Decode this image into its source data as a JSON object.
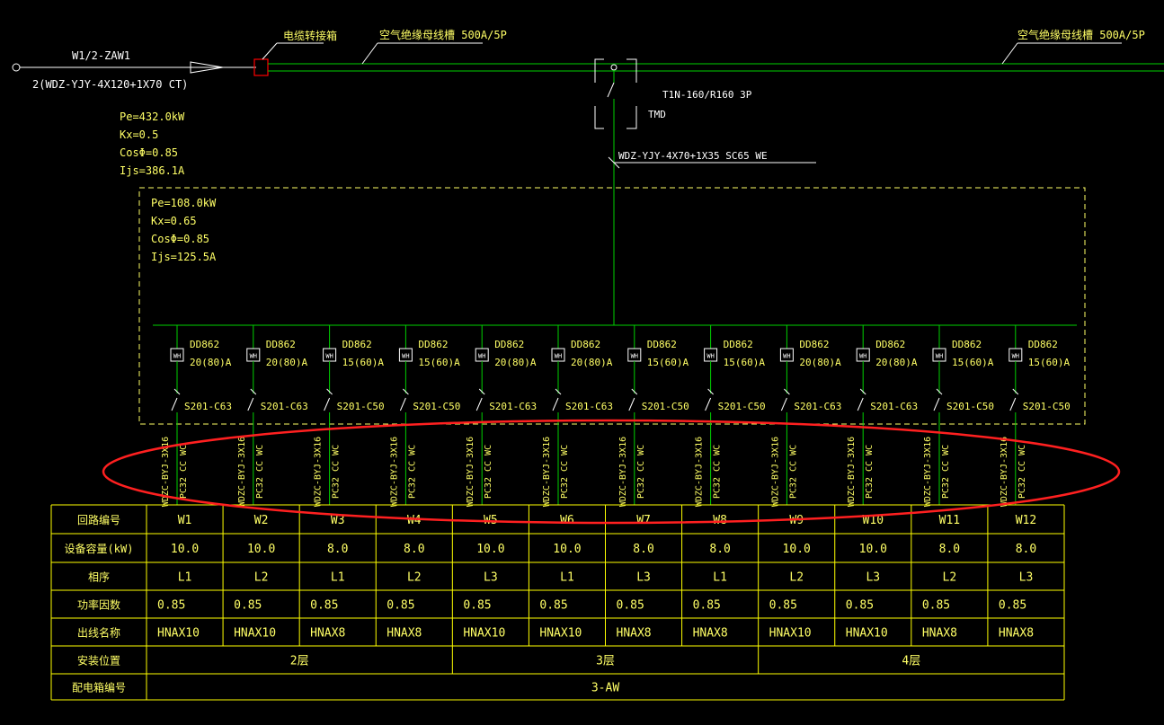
{
  "incoming": {
    "feeder_id": "W1/2-ZAW1",
    "cable": "2(WDZ-YJY-4X120+1X70 CT)",
    "cable_box_label": "电缆转接箱",
    "busway_left": "空气绝缘母线槽 500A/5P",
    "busway_right": "空气绝缘母线槽 500A/5P",
    "load_pe": "Pe=432.0kW",
    "load_kx": "Kx=0.5",
    "load_cos": "CosΦ=0.85",
    "load_ijs": "Ijs=386.1A"
  },
  "tap": {
    "breaker": "T1N-160/R160 3P",
    "tmd": "TMD",
    "cable": "WDZ-YJY-4X70+1X35 SC65 WE"
  },
  "panel": {
    "load_pe": "Pe=108.0kW",
    "load_kx": "Kx=0.65",
    "load_cos": "CosΦ=0.85",
    "load_ijs": "Ijs=125.5A"
  },
  "branches": [
    {
      "meter": "DD862",
      "rating": "20(80)A",
      "mcb": "S201-C63",
      "cable": "WDZC-BYJ-3X16",
      "conduit": "PC32 CC WC"
    },
    {
      "meter": "DD862",
      "rating": "20(80)A",
      "mcb": "S201-C63",
      "cable": "WDZC-BYJ-3X16",
      "conduit": "PC32 CC WC"
    },
    {
      "meter": "DD862",
      "rating": "15(60)A",
      "mcb": "S201-C50",
      "cable": "WDZC-BYJ-3X16",
      "conduit": "PC32 CC WC"
    },
    {
      "meter": "DD862",
      "rating": "15(60)A",
      "mcb": "S201-C50",
      "cable": "WDZC-BYJ-3X16",
      "conduit": "PC32 CC WC"
    },
    {
      "meter": "DD862",
      "rating": "20(80)A",
      "mcb": "S201-C63",
      "cable": "WDZC-BYJ-3X16",
      "conduit": "PC32 CC WC"
    },
    {
      "meter": "DD862",
      "rating": "20(80)A",
      "mcb": "S201-C63",
      "cable": "WDZC-BYJ-3X16",
      "conduit": "PC32 CC WC"
    },
    {
      "meter": "DD862",
      "rating": "15(60)A",
      "mcb": "S201-C50",
      "cable": "WDZC-BYJ-3X16",
      "conduit": "PC32 CC WC"
    },
    {
      "meter": "DD862",
      "rating": "15(60)A",
      "mcb": "S201-C50",
      "cable": "WDZC-BYJ-3X16",
      "conduit": "PC32 CC WC"
    },
    {
      "meter": "DD862",
      "rating": "20(80)A",
      "mcb": "S201-C63",
      "cable": "WDZC-BYJ-3X16",
      "conduit": "PC32 CC WC"
    },
    {
      "meter": "DD862",
      "rating": "20(80)A",
      "mcb": "S201-C63",
      "cable": "WDZC-BYJ-3X16",
      "conduit": "PC32 CC WC"
    },
    {
      "meter": "DD862",
      "rating": "15(60)A",
      "mcb": "S201-C50",
      "cable": "WDZC-BYJ-3X16",
      "conduit": "PC32 CC WC"
    },
    {
      "meter": "DD862",
      "rating": "15(60)A",
      "mcb": "S201-C50",
      "cable": "WDZC-BYJ-3X16",
      "conduit": "PC32 CC WC"
    }
  ],
  "meter_symbol": "WH",
  "table": {
    "row_labels": [
      "回路编号",
      "设备容量(kW)",
      "相序",
      "功率因数",
      "出线名称",
      "安装位置",
      "配电箱编号"
    ],
    "circuit_ids": [
      "W1",
      "W2",
      "W3",
      "W4",
      "W5",
      "W6",
      "W7",
      "W8",
      "W9",
      "W10",
      "W11",
      "W12"
    ],
    "capacities": [
      "10.0",
      "10.0",
      "8.0",
      "8.0",
      "10.0",
      "10.0",
      "8.0",
      "8.0",
      "10.0",
      "10.0",
      "8.0",
      "8.0"
    ],
    "phases": [
      "L1",
      "L2",
      "L1",
      "L2",
      "L3",
      "L1",
      "L3",
      "L1",
      "L2",
      "L3",
      "L2",
      "L3"
    ],
    "power_factors": [
      "0.85",
      "0.85",
      "0.85",
      "0.85",
      "0.85",
      "0.85",
      "0.85",
      "0.85",
      "0.85",
      "0.85",
      "0.85",
      "0.85"
    ],
    "outlet_names": [
      "HNAX10",
      "HNAX10",
      "HNAX8",
      "HNAX8",
      "HNAX10",
      "HNAX10",
      "HNAX8",
      "HNAX8",
      "HNAX10",
      "HNAX10",
      "HNAX8",
      "HNAX8"
    ],
    "locations": [
      "2层",
      "3层",
      "4层"
    ],
    "box_id": "3-AW"
  },
  "colors": {
    "background": "#000000",
    "wire": "#00d000",
    "text_yellow": "#ffff66",
    "table_line": "#ffff00",
    "breaker_frame": "#ffffff",
    "cable_box": "#ff0000",
    "highlight_ellipse": "#ff2020"
  }
}
